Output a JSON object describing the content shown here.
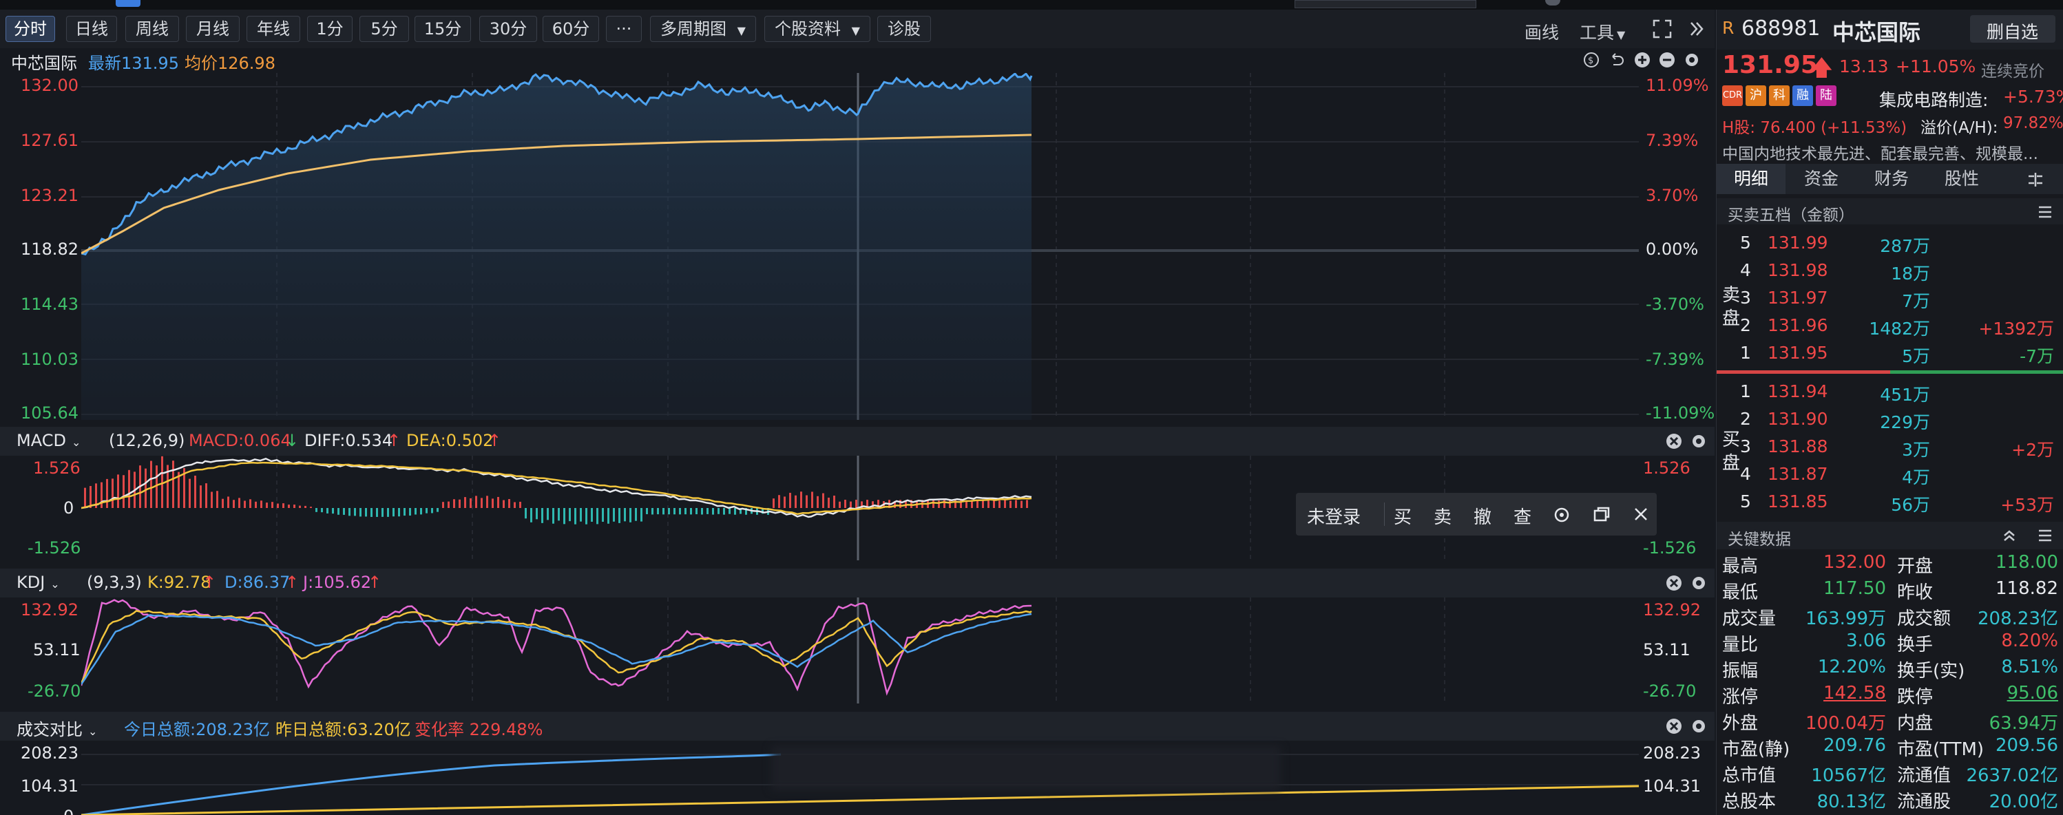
{
  "toolbar": {
    "periods": [
      "分时",
      "日线",
      "周线",
      "月线",
      "年线",
      "1分",
      "5分",
      "15分",
      "30分",
      "60分"
    ],
    "more": "···",
    "multi_period": "多周期图",
    "stock_info": "个股资料",
    "diagnose": "诊股",
    "draw": "画线",
    "tools": "工具"
  },
  "main_chart": {
    "stock_name": "中芯国际",
    "latest": "最新131.95",
    "avg": "均价126.98",
    "left_ticks": [
      "132.00",
      "127.61",
      "123.21",
      "118.82",
      "114.43",
      "110.03",
      "105.64"
    ],
    "right_ticks": [
      "11.09%",
      "7.39%",
      "3.70%",
      "0.00%",
      "-3.70%",
      "-7.39%",
      "-11.09%"
    ]
  },
  "macd": {
    "name": "MACD",
    "params": "(12,26,9)",
    "macd": "MACD:0.064",
    "diff": "DIFF:0.534",
    "dea": "DEA:0.502",
    "ticks": [
      "1.526",
      "0",
      "-1.526"
    ],
    "right_ticks": [
      "1.526",
      "-1.526"
    ]
  },
  "kdj": {
    "name": "KDJ",
    "params": "(9,3,3)",
    "k": "K:92.78",
    "d": "D:86.37",
    "j": "J:105.62",
    "ticks": [
      "132.92",
      "53.11",
      "-26.70"
    ],
    "right_ticks": [
      "132.92",
      "53.11",
      "-26.70"
    ]
  },
  "volume_compare": {
    "name": "成交对比",
    "today": "今日总额:208.23亿",
    "yesterday": "昨日总额:63.20亿",
    "change": "变化率 229.48%",
    "ticks": [
      "208.23",
      "104.31",
      "0"
    ],
    "right_ticks": [
      "208.23",
      "104.31"
    ]
  },
  "context_menu": {
    "login": "未登录",
    "buy": "买",
    "sell": "卖",
    "cancel": "撤",
    "query": "查"
  },
  "quote": {
    "market": "R",
    "code": "688981",
    "name": "中芯国际",
    "remove_watch": "删自选",
    "price": "131.95",
    "change": "13.13",
    "change_pct": "+11.05%",
    "status": "连续竞价",
    "badges": [
      "CDR",
      "沪",
      "科",
      "融",
      "陆"
    ],
    "sector": "集成电路制造:",
    "sector_pct": "+5.73%",
    "h_share": "H股: 76.400 (+11.53%)",
    "premium_label": "溢价(A/H):",
    "premium": "97.82%",
    "desc": "中国内地技术最先进、配套最完善、规模最..."
  },
  "tabs": [
    "明细",
    "资金",
    "财务",
    "股性"
  ],
  "order_book": {
    "title": "买卖五档（金额）",
    "sell_label": [
      "卖",
      "盘"
    ],
    "buy_label": [
      "买",
      "盘"
    ],
    "sells": [
      {
        "level": "5",
        "price": "131.99",
        "amount": "287万",
        "delta": ""
      },
      {
        "level": "4",
        "price": "131.98",
        "amount": "18万",
        "delta": ""
      },
      {
        "level": "3",
        "price": "131.97",
        "amount": "7万",
        "delta": ""
      },
      {
        "level": "2",
        "price": "131.96",
        "amount": "1482万",
        "delta": "+1392万"
      },
      {
        "level": "1",
        "price": "131.95",
        "amount": "5万",
        "delta": "-7万"
      }
    ],
    "buys": [
      {
        "level": "1",
        "price": "131.94",
        "amount": "451万",
        "delta": ""
      },
      {
        "level": "2",
        "price": "131.90",
        "amount": "229万",
        "delta": ""
      },
      {
        "level": "3",
        "price": "131.88",
        "amount": "3万",
        "delta": "+2万"
      },
      {
        "level": "4",
        "price": "131.87",
        "amount": "4万",
        "delta": ""
      },
      {
        "level": "5",
        "price": "131.85",
        "amount": "56万",
        "delta": "+53万"
      }
    ]
  },
  "key_data": {
    "title": "关键数据",
    "rows": [
      [
        "最高",
        "132.00",
        "开盘",
        "118.00"
      ],
      [
        "最低",
        "117.50",
        "昨收",
        "118.82"
      ],
      [
        "成交量",
        "163.99万",
        "成交额",
        "208.23亿"
      ],
      [
        "量比",
        "3.06",
        "换手",
        "8.20%"
      ],
      [
        "振幅",
        "12.20%",
        "换手(实)",
        "8.51%"
      ],
      [
        "涨停",
        "142.58",
        "跌停",
        "95.06"
      ],
      [
        "外盘",
        "100.04万",
        "内盘",
        "63.94万"
      ],
      [
        "市盈(静)",
        "209.76",
        "市盈(TTM)",
        "209.56"
      ],
      [
        "总市值",
        "10567亿",
        "流通值",
        "2637.02亿"
      ],
      [
        "总股本",
        "80.13亿",
        "流通股",
        "20.00亿"
      ]
    ]
  }
}
